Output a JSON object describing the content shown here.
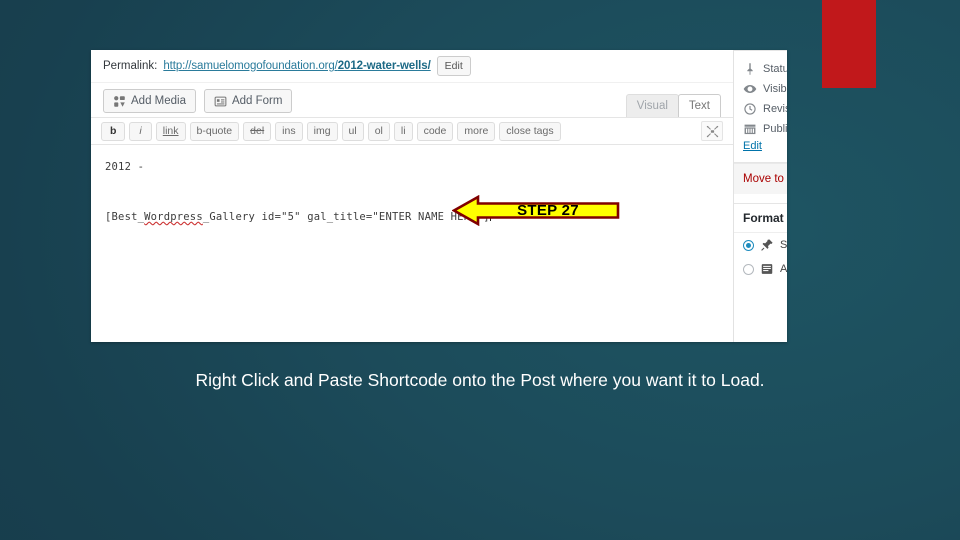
{
  "slide": {
    "caption": "Right Click and Paste Shortcode onto the Post where you want it to Load.",
    "accent_color": "#c1181b",
    "background_color": "#1c4b5a"
  },
  "callout": {
    "label": "STEP 27",
    "fill_color": "#ffff00",
    "border_color": "#800000",
    "direction": "left"
  },
  "editor": {
    "permalink": {
      "label": "Permalink:",
      "url_prefix": "http://samuelomogofoundation.org/",
      "url_slug": "2012-water-wells/",
      "edit_button": "Edit"
    },
    "media_buttons": [
      {
        "label": "Add Media",
        "icon": "media-icon"
      },
      {
        "label": "Add Form",
        "icon": "form-icon"
      }
    ],
    "tabs": [
      {
        "label": "Visual",
        "active": false
      },
      {
        "label": "Text",
        "active": true
      }
    ],
    "quicktags": [
      "b",
      "i",
      "link",
      "b-quote",
      "del",
      "ins",
      "img",
      "ul",
      "ol",
      "li",
      "code",
      "more",
      "close tags"
    ],
    "fullscreen_icon": "fullscreen-icon",
    "content": {
      "line1": "2012 -",
      "line2_prefix": "[Best_",
      "line2_misspelled": "Wordpress",
      "line2_suffix": "_Gallery id=\"5\" gal_title=\"ENTER NAME HERE\"]"
    }
  },
  "sidebar": {
    "publish": {
      "rows": [
        {
          "label": "Statu",
          "icon": "pin-icon"
        },
        {
          "label": "Visib",
          "icon": "eye-icon"
        },
        {
          "label": "Revis",
          "icon": "clock-icon"
        },
        {
          "label": "Publi",
          "icon": "calendar-icon"
        }
      ],
      "edit_link": "Edit",
      "trash_label": "Move to"
    },
    "format": {
      "title": "Format",
      "options": [
        {
          "label": "S",
          "icon": "pin-icon",
          "selected": true
        },
        {
          "label": "A",
          "icon": "aside-icon",
          "selected": false
        }
      ]
    }
  }
}
